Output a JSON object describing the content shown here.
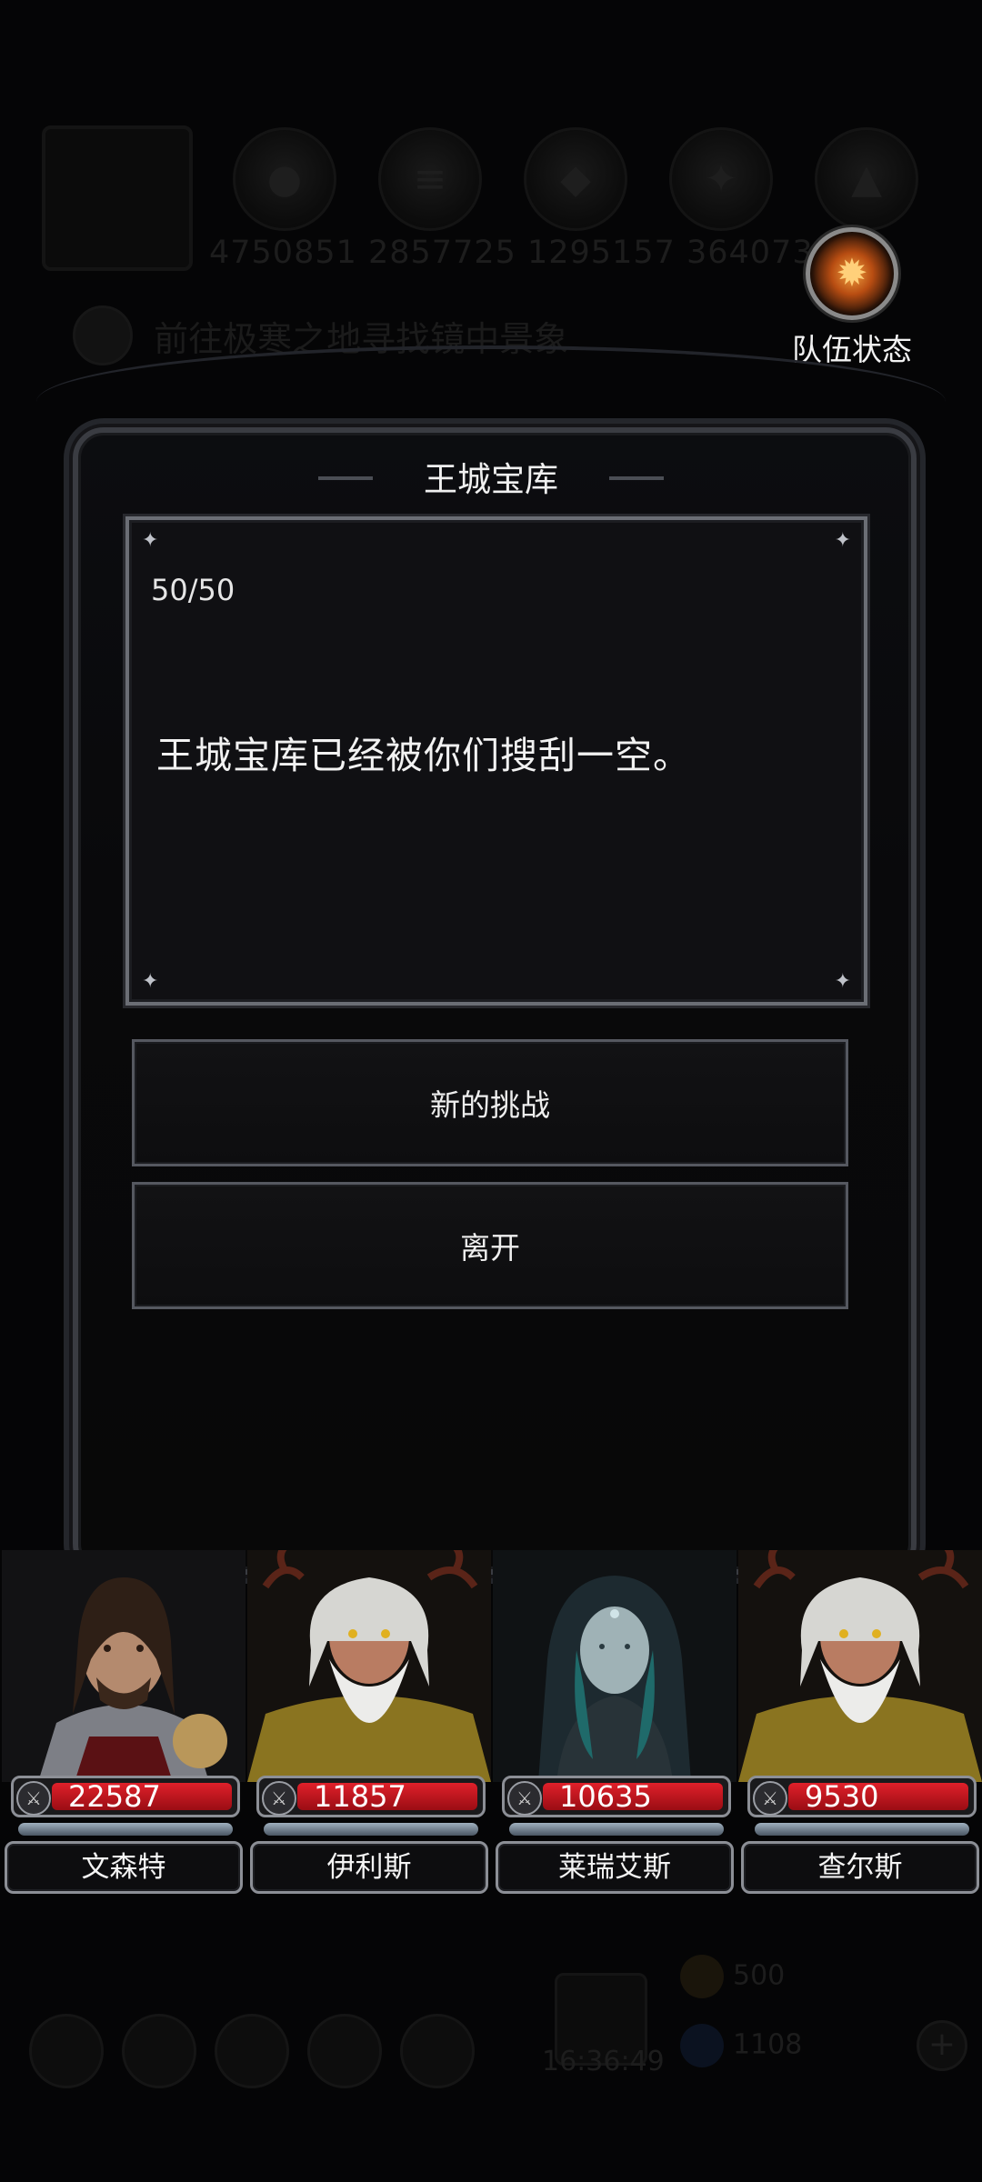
{
  "background_hud": {
    "resource_values": "4750851  2857725  1295157  364073  751",
    "quest_text": "前往极寒之地寻找镜中景象",
    "time": "16:36:49",
    "currency_gold": "500",
    "currency_gem": "1108"
  },
  "team_status": {
    "label": "队伍状态",
    "icon": "fire-emblem-icon"
  },
  "modal": {
    "title": "王城宝库",
    "progress": "50/50",
    "message": "王城宝库已经被你们搜刮一空。",
    "options": [
      {
        "label": "新的挑战"
      },
      {
        "label": "离开"
      }
    ]
  },
  "party": [
    {
      "name": "文森特",
      "hp": "22587"
    },
    {
      "name": "伊利斯",
      "hp": "11857"
    },
    {
      "name": "莱瑞艾斯",
      "hp": "10635"
    },
    {
      "name": "查尔斯",
      "hp": "9530"
    }
  ],
  "colors": {
    "hp_red": "#c4141c",
    "frame_silver": "#8c8f96",
    "background": "#050506"
  }
}
